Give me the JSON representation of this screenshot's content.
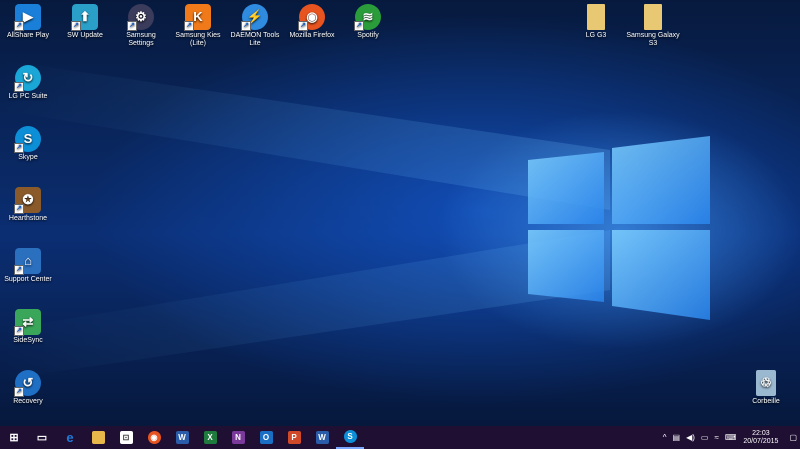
{
  "desktop_icons": [
    {
      "label": "AllShare Play",
      "icon": "allshare-icon",
      "color": "#1a7fd8",
      "glyph": "▶"
    },
    {
      "label": "SW Update",
      "icon": "sw-update-icon",
      "color": "#2aa0c8",
      "glyph": "⬆"
    },
    {
      "label": "Samsung Settings",
      "icon": "samsung-settings-icon",
      "color": "#3b3b5c",
      "glyph": "⚙"
    },
    {
      "label": "Samsung Kies (Lite)",
      "icon": "kies-icon",
      "color": "#f07a1a",
      "glyph": "K"
    },
    {
      "label": "DAEMON Tools Lite",
      "icon": "daemon-tools-icon",
      "color": "#2f8be0",
      "glyph": "⚡"
    },
    {
      "label": "Mozilla Firefox",
      "icon": "firefox-icon",
      "color": "#e8541f",
      "glyph": "◉"
    },
    {
      "label": "Spotify",
      "icon": "spotify-icon",
      "color": "#2a9d3a",
      "glyph": "≋"
    },
    {
      "label": "LG G3",
      "icon": "folder-icon",
      "color": "#e8c872",
      "glyph": ""
    },
    {
      "label": "Samsung Galaxy S3",
      "icon": "folder-icon",
      "color": "#e8c872",
      "glyph": ""
    },
    {
      "label": "LG PC Suite",
      "icon": "lg-pc-suite-icon",
      "color": "#1aa6d6",
      "glyph": "↻"
    },
    {
      "label": "Skype",
      "icon": "skype-icon",
      "color": "#0d8fd8",
      "glyph": "S"
    },
    {
      "label": "Hearthstone",
      "icon": "hearthstone-icon",
      "color": "#8a5a2a",
      "glyph": "✪"
    },
    {
      "label": "Support Center",
      "icon": "support-center-icon",
      "color": "#2b6fbf",
      "glyph": "⌂"
    },
    {
      "label": "SideSync",
      "icon": "sidesync-icon",
      "color": "#3aa65a",
      "glyph": "⇄"
    },
    {
      "label": "Recovery",
      "icon": "recovery-icon",
      "color": "#1f6fc4",
      "glyph": "↺"
    },
    {
      "label": "Corbeille",
      "icon": "recycle-bin-icon",
      "color": "#9ab8d0",
      "glyph": "♲"
    }
  ],
  "taskbar": {
    "apps": [
      {
        "icon": "windows-start-icon",
        "glyph": "⊞",
        "color": "transparent"
      },
      {
        "icon": "task-view-icon",
        "glyph": "▭",
        "color": "transparent"
      },
      {
        "icon": "edge-icon",
        "glyph": "e",
        "color": "#1f7ad8"
      },
      {
        "icon": "file-explorer-icon",
        "glyph": "▬",
        "color": "#e8b84a"
      },
      {
        "icon": "store-icon",
        "glyph": "⊡",
        "color": "#ffffff"
      },
      {
        "icon": "firefox-icon",
        "glyph": "◉",
        "color": "#e8541f"
      },
      {
        "icon": "word-icon",
        "glyph": "W",
        "color": "#2a5caa"
      },
      {
        "icon": "excel-icon",
        "glyph": "X",
        "color": "#1f7a3e"
      },
      {
        "icon": "onenote-icon",
        "glyph": "N",
        "color": "#7a3a9a"
      },
      {
        "icon": "outlook-icon",
        "glyph": "O",
        "color": "#1a6fc4"
      },
      {
        "icon": "powerpoint-icon",
        "glyph": "P",
        "color": "#d04a2a"
      },
      {
        "icon": "word-icon",
        "glyph": "W",
        "color": "#2a5caa"
      },
      {
        "icon": "skype-icon",
        "glyph": "S",
        "color": "#0d8fd8"
      }
    ],
    "tray": {
      "time": "22:03",
      "date": "20/07/2015"
    }
  }
}
